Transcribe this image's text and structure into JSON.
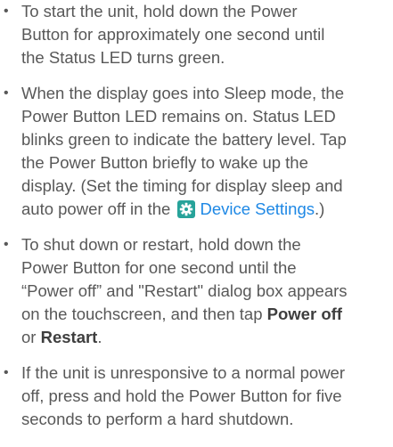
{
  "bullets": [
    {
      "lines": [
        "To start the unit, hold down the Power",
        "Button for approximately one second until",
        "the Status LED  turns green."
      ]
    },
    {
      "lines": [
        "When the display goes into Sleep mode, the",
        "Power Button LED remains on. Status LED",
        "blinks green to indicate the battery level. Tap",
        "the Power Button briefly to wake up the",
        "display. (Set the timing for display sleep and"
      ],
      "last_line_prefix": "auto power off in the",
      "link_text": "Device Settings",
      "last_line_suffix": ".)",
      "icon": "gear-icon"
    },
    {
      "lines": [
        "To shut down or restart, hold down the",
        "Power Button for one second until the",
        "“Power off” and \"Restart\" dialog box appears"
      ],
      "line4_prefix": "on the touchscreen, and then tap",
      "power_off_label": "Power off",
      "line5_prefix": "or",
      "restart_label": "Restart",
      "line5_suffix": "."
    },
    {
      "lines": [
        "If the unit is unresponsive to a normal power",
        "off, press and hold the Power Button for five",
        "seconds to perform a hard shutdown."
      ]
    }
  ],
  "bullet_symbol": "•",
  "colors": {
    "text": "#585858",
    "link": "#1e88e5",
    "icon_bg": "#27a39a"
  }
}
